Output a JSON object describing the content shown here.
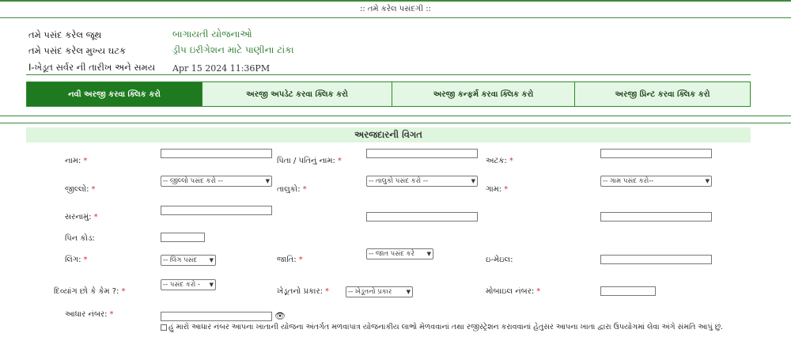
{
  "banner": ":: તમે કરેલ પસંદગી ::",
  "info": [
    {
      "label": "તમે પસંદ કરેલ જૂથ",
      "value": "બાગાયતી યોજનાઓ"
    },
    {
      "label": "તમે પસંદ કરેલ મુખ્ય ઘટક",
      "value": "ડ્રીપ ઇરીગેશન માટે પાણીના ટાંકા"
    },
    {
      "label": "I-ખેડૂત સર્વર ની તારીખ અને સમય",
      "value": "Apr 15 2024 11:36PM"
    }
  ],
  "tabs": [
    {
      "label": "નવી અરજી કરવા ક્લિક કરો"
    },
    {
      "label": "અરજી અપડેટ કરવા ક્લિક કરો"
    },
    {
      "label": "અરજી કન્ફર્મ કરવા ક્લિક કરો"
    },
    {
      "label": "અરજી પ્રિન્ટ કરવા ક્લિક કરો"
    }
  ],
  "section_title": "અરજદારની વિગત",
  "required_mark": "*",
  "form": {
    "name": "નામ:",
    "father": "પિતા / પતિનું નામ:",
    "surname": "અટક:",
    "district": "જીલ્લો:",
    "district_sel": "-- જીલ્લો પસંદ કરો --",
    "taluka": "તાલુકો:",
    "taluka_sel": "-- તાલુકો પસંદ કરો --",
    "village": "ગામ:",
    "village_sel": "-- ગામ પસંદ કરો--",
    "address": "સરનામું:",
    "pincode": "પિન કોડ:",
    "gender": "લિંગ:",
    "gender_sel": "-- લિંગ પસંદ",
    "caste": "જાતિ:",
    "caste_sel": "-- જાત પસંદ કરે",
    "email": "ઇ-મેઇલ:",
    "disabled": "દિવ્યાંગ છો કે કેમ ?:",
    "disabled_sel": "-- પસંદ કરો -",
    "farmer_type": "ખેડૂતનો પ્રકાર:",
    "farmer_type_sel": "-- ખેડૂતનો પ્રકાર",
    "mobile": "મોબાઇલ નંબર:",
    "aadhaar": "આધાર નંબર:",
    "consent": "હું મારો આધાર નંબર આપના ખાતાની યોજના અંતર્ગત મળવાપાત્ર યોજનાકીય લાભો મેળવવાનાં તથા રજીસ્ટ્રેશન કરાવવાનાં હેતુસર આપના ખાતા દ્વારા ઉપયોગમાં લેવા અંગે સંમતિ આપું છું."
  },
  "colors": {
    "accent": "#1f7a1f",
    "tab_bg": "#e4f7e4",
    "header_bg": "#def5de",
    "required": "#d32f2f",
    "value_text": "#2e7d32"
  },
  "icons": {
    "aadhaar_toggle": "eye-icon"
  }
}
